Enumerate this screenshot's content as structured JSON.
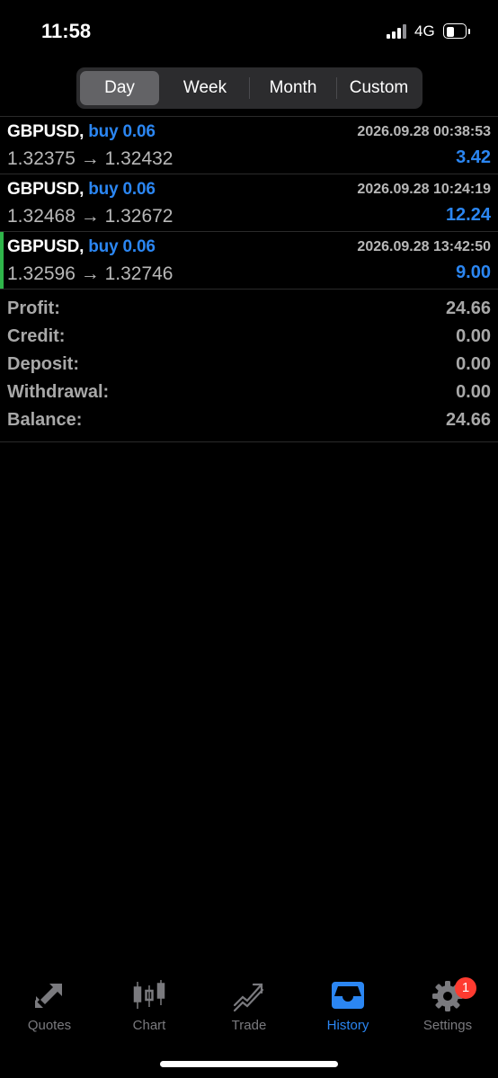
{
  "status_bar": {
    "time": "11:58",
    "network": "4G"
  },
  "segments": {
    "day": "Day",
    "week": "Week",
    "month": "Month",
    "custom": "Custom",
    "selected": "Day"
  },
  "deals": [
    {
      "symbol": "GBPUSD,",
      "side": "buy 0.06",
      "time": "2026.09.28 00:38:53",
      "prices": "1.32375 → 1.32432",
      "profit": "3.42",
      "marker": false
    },
    {
      "symbol": "GBPUSD,",
      "side": "buy 0.06",
      "time": "2026.09.28 10:24:19",
      "prices": "1.32468 → 1.32672",
      "profit": "12.24",
      "marker": false
    },
    {
      "symbol": "GBPUSD,",
      "side": "buy 0.06",
      "time": "2026.09.28 13:42:50",
      "prices": "1.32596 → 1.32746",
      "profit": "9.00",
      "marker": true
    }
  ],
  "summary": [
    {
      "label": "Profit:",
      "value": "24.66"
    },
    {
      "label": "Credit:",
      "value": "0.00"
    },
    {
      "label": "Deposit:",
      "value": "0.00"
    },
    {
      "label": "Withdrawal:",
      "value": "0.00"
    },
    {
      "label": "Balance:",
      "value": "24.66"
    }
  ],
  "tabbar": {
    "items": [
      {
        "label": "Quotes",
        "icon": "quotes-arrows-icon"
      },
      {
        "label": "Chart",
        "icon": "candlestick-icon"
      },
      {
        "label": "Trade",
        "icon": "trade-lines-icon"
      },
      {
        "label": "History",
        "icon": "inbox-tray-icon"
      },
      {
        "label": "Settings",
        "icon": "gear-icon"
      }
    ],
    "active": "History",
    "settings_badge": "1"
  },
  "colors": {
    "accent": "#2b86f2",
    "background": "#000000",
    "muted_text": "#a8a8a8",
    "marker": "#2fb54a",
    "badge": "#ff3b30"
  }
}
